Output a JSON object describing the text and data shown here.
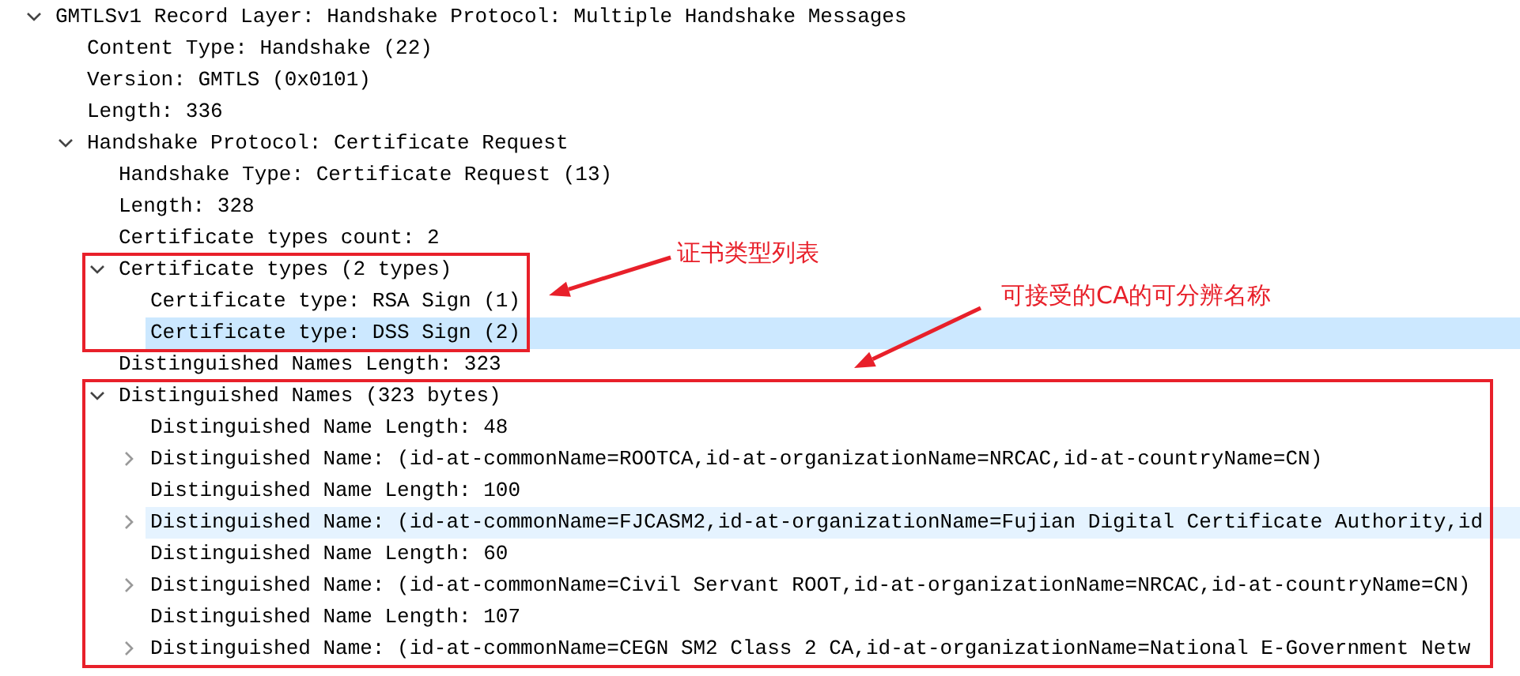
{
  "tree": [
    {
      "text": "GMTLSv1 Record Layer: Handshake Protocol: Multiple Handshake Messages",
      "expanded": true,
      "selected": false,
      "hovered": false,
      "children": [
        {
          "text": "Content Type: Handshake (22)",
          "selected": false,
          "hovered": false
        },
        {
          "text": "Version: GMTLS (0x0101)",
          "selected": false,
          "hovered": false
        },
        {
          "text": "Length: 336",
          "selected": false,
          "hovered": false
        },
        {
          "text": "Handshake Protocol: Certificate Request",
          "expanded": true,
          "selected": false,
          "hovered": false,
          "children": [
            {
              "text": "Handshake Type: Certificate Request (13)",
              "selected": false,
              "hovered": false
            },
            {
              "text": "Length: 328",
              "selected": false,
              "hovered": false
            },
            {
              "text": "Certificate types count: 2",
              "selected": false,
              "hovered": false
            },
            {
              "text": "Certificate types (2 types)",
              "expanded": true,
              "selected": false,
              "hovered": false,
              "callout": {
                "text": "证书类型列表"
              },
              "children": [
                {
                  "text": "Certificate type: RSA Sign (1)",
                  "selected": false,
                  "hovered": false
                },
                {
                  "text": "Certificate type: DSS Sign (2)",
                  "selected": true,
                  "hovered": false
                }
              ]
            },
            {
              "text": "Distinguished Names Length: 323",
              "selected": false,
              "hovered": false
            },
            {
              "text": "Distinguished Names (323 bytes)",
              "expanded": true,
              "selected": false,
              "hovered": false,
              "callout": {
                "text": "可接受的CA的可分辨名称"
              },
              "children": [
                {
                  "text": "Distinguished Name Length: 48",
                  "selected": false,
                  "hovered": false
                },
                {
                  "text": "Distinguished Name: (id-at-commonName=ROOTCA,id-at-organizationName=NRCAC,id-at-countryName=CN)",
                  "expanded": false,
                  "selected": false,
                  "hovered": false
                },
                {
                  "text": "Distinguished Name Length: 100",
                  "selected": false,
                  "hovered": false
                },
                {
                  "text": "Distinguished Name: (id-at-commonName=FJCASM2,id-at-organizationName=Fujian Digital Certificate Authority,id",
                  "expanded": false,
                  "selected": false,
                  "hovered": true
                },
                {
                  "text": "Distinguished Name Length: 60",
                  "selected": false,
                  "hovered": false
                },
                {
                  "text": "Distinguished Name: (id-at-commonName=Civil Servant ROOT,id-at-organizationName=NRCAC,id-at-countryName=CN)",
                  "expanded": false,
                  "selected": false,
                  "hovered": false
                },
                {
                  "text": "Distinguished Name Length: 107",
                  "selected": false,
                  "hovered": false
                },
                {
                  "text": "Distinguished Name: (id-at-commonName=CEGN SM2 Class 2 CA,id-at-organizationName=National E-Government Netw",
                  "expanded": false,
                  "selected": false,
                  "hovered": false
                }
              ]
            }
          ]
        }
      ]
    }
  ]
}
